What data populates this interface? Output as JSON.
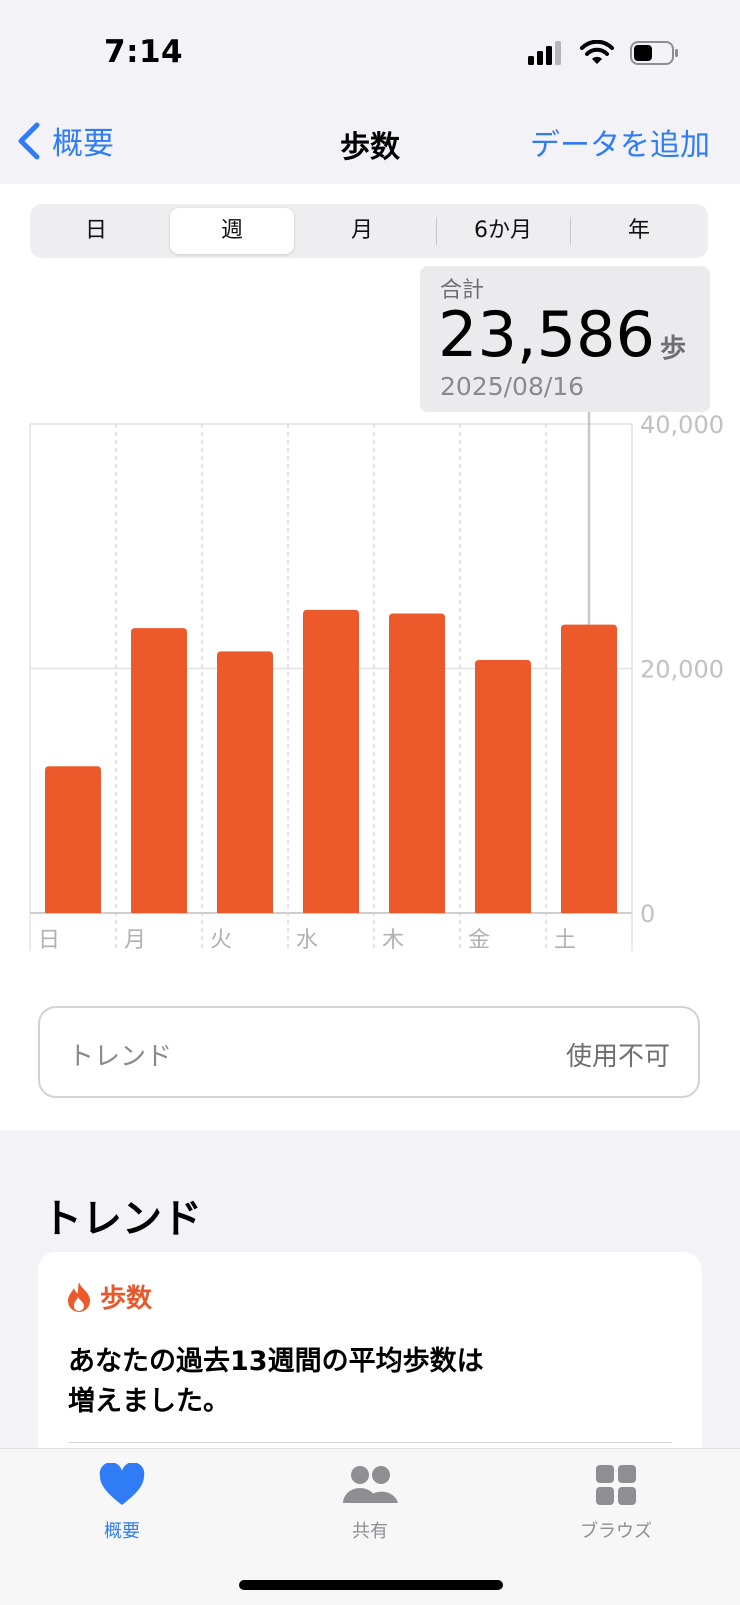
{
  "status_bar": {
    "time": "7:14"
  },
  "nav": {
    "back_label": "概要",
    "title": "歩数",
    "add_label": "データを追加"
  },
  "range_selector": {
    "options": [
      "日",
      "週",
      "月",
      "6か月",
      "年"
    ],
    "selected_index": 1
  },
  "summary": {
    "label": "合計",
    "value": "23,586",
    "unit": "歩",
    "date": "2025/08/16"
  },
  "chart_data": {
    "type": "bar",
    "categories": [
      "日",
      "月",
      "火",
      "水",
      "木",
      "金",
      "土"
    ],
    "values": [
      12000,
      23300,
      21400,
      24800,
      24500,
      20700,
      23586
    ],
    "ylim": [
      0,
      40000
    ],
    "y_ticks": [
      "0",
      "20,000",
      "40,000"
    ],
    "y_tick_values": [
      0,
      20000,
      40000
    ],
    "highlighted_category": "土",
    "bar_color": "#ec5a2b"
  },
  "trend_pill": {
    "label": "トレンド",
    "value": "使用不可"
  },
  "trends": {
    "title": "トレンド",
    "card": {
      "category": "歩数",
      "text_line1": "あなたの過去13週間の平均歩数は",
      "text_line2": "増えました。"
    }
  },
  "tabbar": {
    "items": [
      {
        "label": "概要",
        "icon": "heart-icon",
        "active": true
      },
      {
        "label": "共有",
        "icon": "people-icon",
        "active": false
      },
      {
        "label": "ブラウズ",
        "icon": "grid-icon",
        "active": false
      }
    ]
  },
  "colors": {
    "accent": "#2f7cf6",
    "steps": "#ec5a2b"
  }
}
